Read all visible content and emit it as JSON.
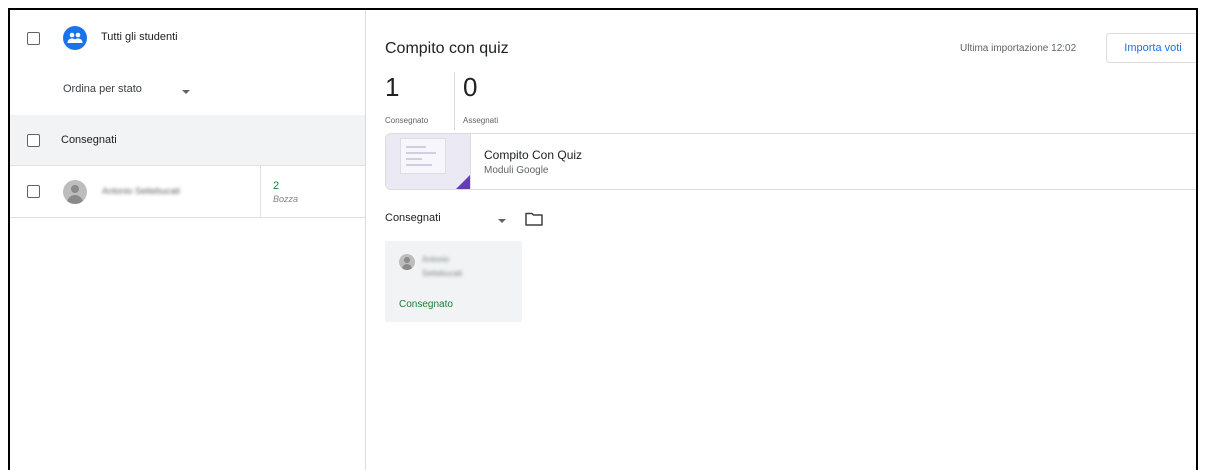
{
  "left_panel": {
    "all_students_label": "Tutti gli studenti",
    "sort_label": "Ordina per stato",
    "group_label": "Consegnati",
    "students": [
      {
        "name": "Antonio Settebucati",
        "grade": "2",
        "status": "Bozza"
      }
    ]
  },
  "assignment": {
    "title": "Compito con quiz",
    "last_import": "Ultima importazione 12:02",
    "import_button": "Importa voti",
    "stats": {
      "turned_in_count": "1",
      "turned_in_label": "Consegnato",
      "assigned_count": "0",
      "assigned_label": "Assegnati"
    },
    "attachment": {
      "title": "Compito Con Quiz",
      "subtitle": "Moduli Google"
    },
    "filter_label": "Consegnati",
    "submissions": [
      {
        "name_line1": "Antonio",
        "name_line2": "Settebucati",
        "status": "Consegnato"
      }
    ]
  },
  "colors": {
    "accent": "#1a73e8",
    "success": "#188038",
    "forms_purple": "#673ab7"
  },
  "icons": [
    "people-icon",
    "chevron-down-icon",
    "folder-icon",
    "avatar-icon"
  ]
}
